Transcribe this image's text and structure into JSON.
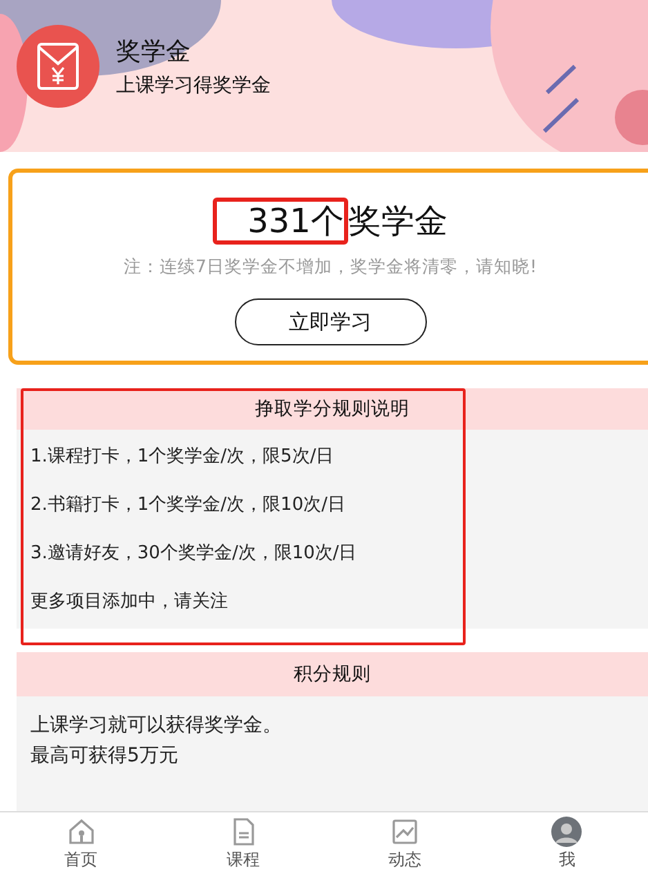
{
  "header": {
    "title": "奖学金",
    "subtitle": "上课学习得奖学金"
  },
  "balance": {
    "count": "331个",
    "unit": "奖学金",
    "note": "注：连续7日奖学金不增加，奖学金将清零，请知晓!",
    "button": "立即学习"
  },
  "earn_rules": {
    "title": "挣取学分规则说明",
    "items": [
      "1.课程打卡，1个奖学金/次，限5次/日",
      "2.书籍打卡，1个奖学金/次，限10次/日",
      "3.邀请好友，30个奖学金/次，限10次/日",
      "更多项目添加中，请关注"
    ]
  },
  "points_rules": {
    "title": "积分规则",
    "lines": [
      "上课学习就可以获得奖学金。",
      "最高可获得5万元"
    ]
  },
  "tabs": [
    {
      "label": "首页",
      "kind": "home",
      "selected": false
    },
    {
      "label": "课程",
      "kind": "document",
      "selected": false
    },
    {
      "label": "动态",
      "kind": "chart",
      "selected": false
    },
    {
      "label": "我",
      "kind": "avatar",
      "selected": false
    }
  ]
}
